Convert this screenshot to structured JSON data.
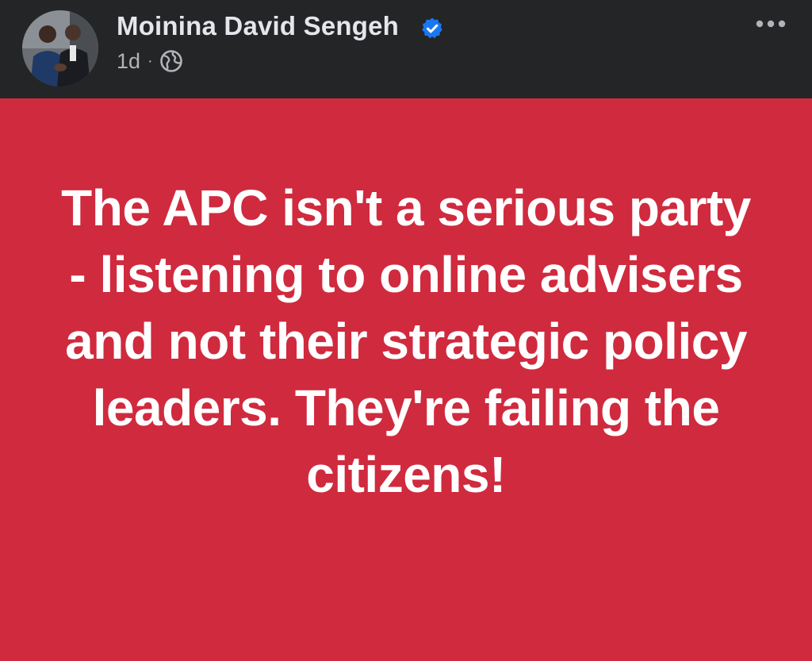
{
  "post": {
    "author_name": "Moinina David Sengeh",
    "verified": true,
    "timestamp": "1d",
    "separator": "·",
    "audience_icon": "globe-icon",
    "more_icon": "more-options-icon",
    "body_text": "The APC isn't a serious party - listening to online advisers and not their strategic policy leaders. They're failing the citizens!",
    "background_color": "#d02a3e",
    "text_color": "#ffffff"
  },
  "colors": {
    "header_bg": "#242526",
    "name_text": "#e4e6eb",
    "meta_text": "#b0b3b8",
    "verified_badge": "#1877f2"
  }
}
